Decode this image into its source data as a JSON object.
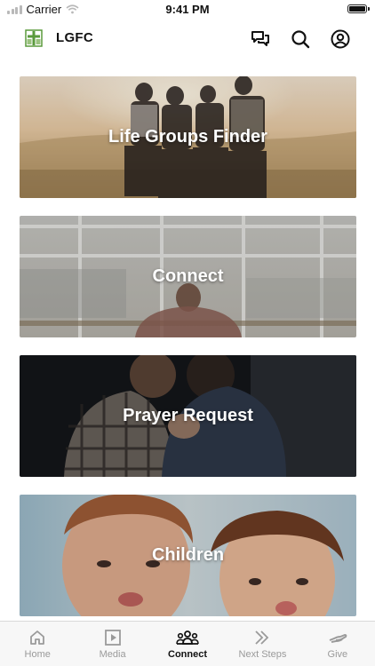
{
  "status_bar": {
    "carrier": "Carrier",
    "time": "9:41 PM"
  },
  "header": {
    "title": "LGFC",
    "icons": [
      "chat-icon",
      "search-icon",
      "profile-icon"
    ]
  },
  "cards": [
    {
      "label": "Life Groups Finder"
    },
    {
      "label": "Connect"
    },
    {
      "label": "Prayer Request"
    },
    {
      "label": "Children"
    }
  ],
  "tab_bar": {
    "tabs": [
      {
        "label": "Home",
        "icon": "home-icon"
      },
      {
        "label": "Media",
        "icon": "media-icon"
      },
      {
        "label": "Connect",
        "icon": "group-icon",
        "active": true
      },
      {
        "label": "Next Steps",
        "icon": "chevrons-icon"
      },
      {
        "label": "Give",
        "icon": "give-icon"
      }
    ]
  },
  "colors": {
    "active_tab": "#111111",
    "inactive_tab": "#9a9a9a",
    "tab_bar_bg": "#f7f7f7",
    "logo_green": "#5a9a3c"
  }
}
